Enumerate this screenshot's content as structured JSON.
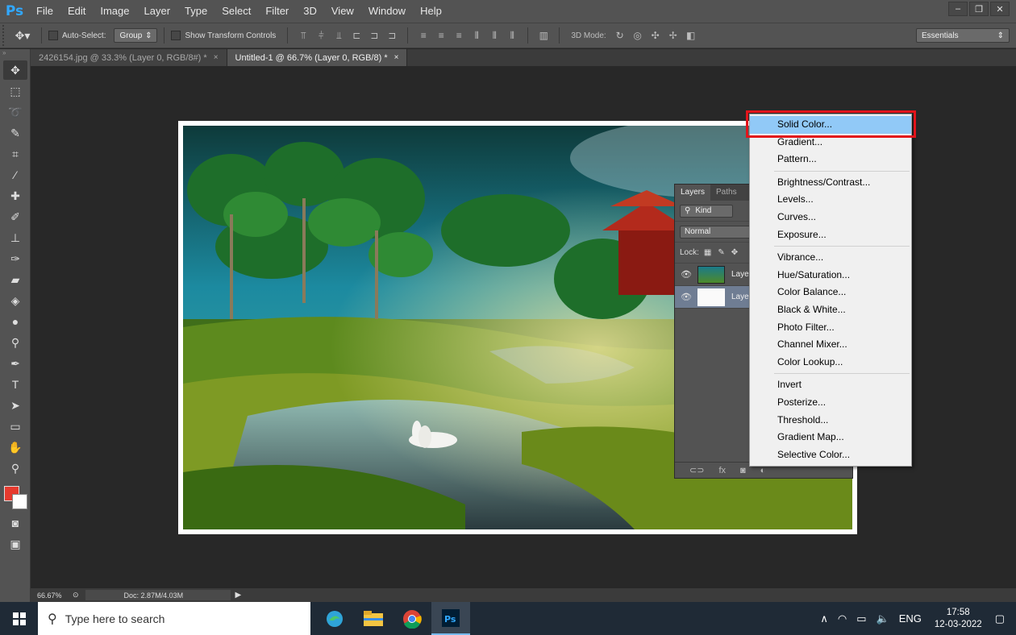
{
  "app": {
    "logo": "Ps"
  },
  "menu": [
    "File",
    "Edit",
    "Image",
    "Layer",
    "Type",
    "Select",
    "Filter",
    "3D",
    "View",
    "Window",
    "Help"
  ],
  "window_controls": [
    "–",
    "❐",
    "✕"
  ],
  "options": {
    "auto_select_label": "Auto-Select:",
    "auto_select_value": "Group",
    "show_transform_label": "Show Transform Controls",
    "mode_3d_label": "3D Mode:",
    "workspace": "Essentials"
  },
  "tabs": [
    {
      "label": "2426154.jpg @ 33.3% (Layer 0, RGB/8#) *",
      "close": "×"
    },
    {
      "label": "Untitled-1 @ 66.7% (Layer 0, RGB/8) *",
      "close": "×"
    }
  ],
  "status": {
    "zoom": "66.67%",
    "doc": "Doc: 2.87M/4.03M"
  },
  "layers_panel": {
    "tabs": [
      "Layers",
      "Paths"
    ],
    "filter": "Kind",
    "blend": "Normal",
    "lock_label": "Lock:",
    "layers": [
      {
        "name": "Laye"
      },
      {
        "name": "Laye"
      }
    ]
  },
  "adjustment_menu": {
    "groups": [
      [
        "Solid Color...",
        "Gradient...",
        "Pattern..."
      ],
      [
        "Brightness/Contrast...",
        "Levels...",
        "Curves...",
        "Exposure..."
      ],
      [
        "Vibrance...",
        "Hue/Saturation...",
        "Color Balance...",
        "Black & White...",
        "Photo Filter...",
        "Channel Mixer...",
        "Color Lookup..."
      ],
      [
        "Invert",
        "Posterize...",
        "Threshold...",
        "Gradient Map...",
        "Selective Color..."
      ]
    ],
    "highlighted": "Solid Color..."
  },
  "taskbar": {
    "search_placeholder": "Type here to search",
    "lang": "ENG",
    "time": "17:58",
    "date": "12-03-2022"
  }
}
